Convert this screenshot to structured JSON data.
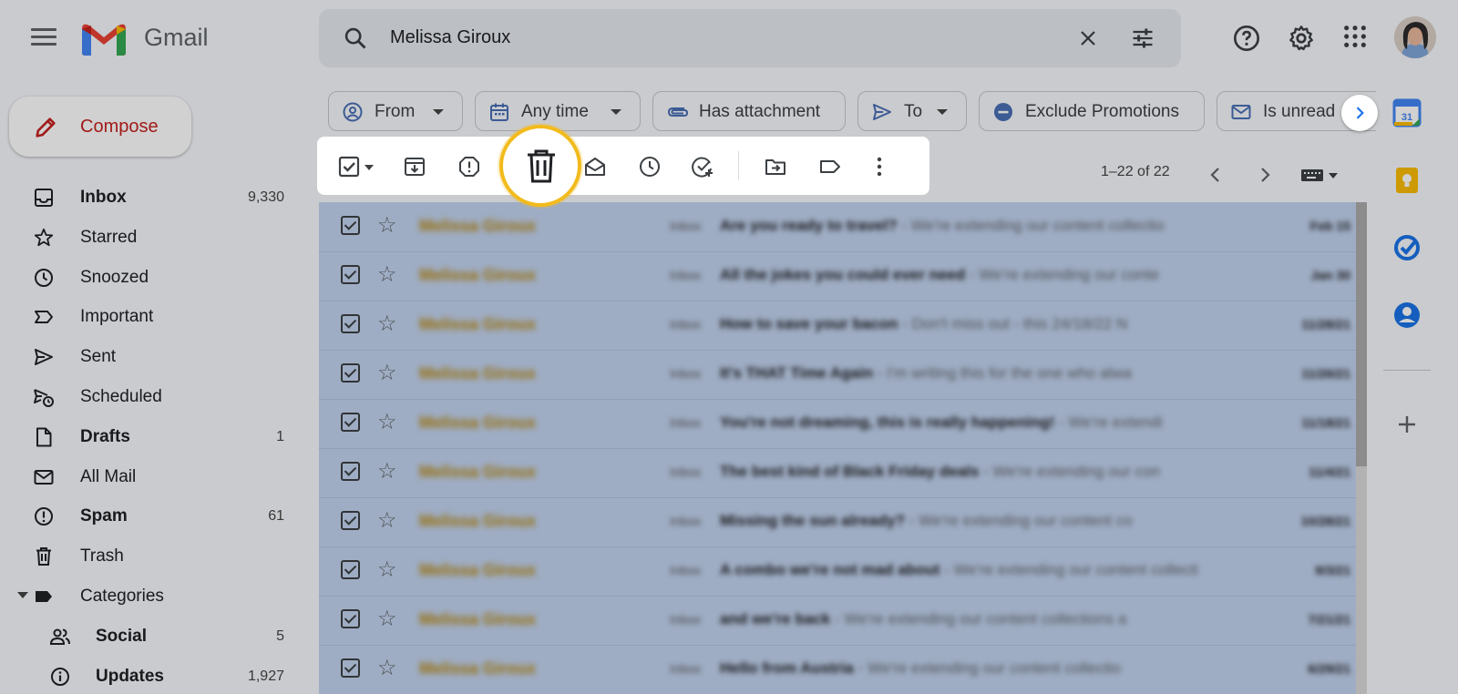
{
  "header": {
    "app_name": "Gmail",
    "search_value": "Melissa Giroux"
  },
  "compose": {
    "label": "Compose"
  },
  "nav": [
    {
      "key": "inbox",
      "label": "Inbox",
      "count": "9,330",
      "bold": true,
      "icon": "inbox-icon"
    },
    {
      "key": "starred",
      "label": "Starred",
      "count": "",
      "bold": false,
      "icon": "star-icon"
    },
    {
      "key": "snoozed",
      "label": "Snoozed",
      "count": "",
      "bold": false,
      "icon": "clock-icon"
    },
    {
      "key": "important",
      "label": "Important",
      "count": "",
      "bold": false,
      "icon": "important-icon"
    },
    {
      "key": "sent",
      "label": "Sent",
      "count": "",
      "bold": false,
      "icon": "send-icon"
    },
    {
      "key": "scheduled",
      "label": "Scheduled",
      "count": "",
      "bold": false,
      "icon": "scheduled-send-icon"
    },
    {
      "key": "drafts",
      "label": "Drafts",
      "count": "1",
      "bold": true,
      "icon": "draft-icon"
    },
    {
      "key": "all-mail",
      "label": "All Mail",
      "count": "",
      "bold": false,
      "icon": "mail-icon"
    },
    {
      "key": "spam",
      "label": "Spam",
      "count": "61",
      "bold": true,
      "icon": "spam-icon"
    },
    {
      "key": "trash",
      "label": "Trash",
      "count": "",
      "bold": false,
      "icon": "trash-icon"
    },
    {
      "key": "categories",
      "label": "Categories",
      "count": "",
      "bold": false,
      "icon": "label-icon"
    },
    {
      "key": "social",
      "label": "Social",
      "count": "5",
      "bold": true,
      "icon": "people-icon"
    },
    {
      "key": "updates",
      "label": "Updates",
      "count": "1,927",
      "bold": true,
      "icon": "info-icon"
    }
  ],
  "chips": [
    {
      "label": "From",
      "icon": "person-icon",
      "caret": true
    },
    {
      "label": "Any time",
      "icon": "calendar-icon",
      "caret": true
    },
    {
      "label": "Has attachment",
      "icon": "attachment-icon",
      "caret": false
    },
    {
      "label": "To",
      "icon": "send-icon",
      "caret": true
    },
    {
      "label": "Exclude Promotions",
      "icon": "minus-circle-icon",
      "caret": false
    },
    {
      "label": "Is unread",
      "icon": "mail-icon",
      "caret": false
    }
  ],
  "pager": {
    "range": "1–22 of 22"
  },
  "emails": [
    {
      "sender": "Melissa Giroux",
      "tag": "Inbox",
      "subject": "Are you ready to travel?",
      "snippet": " - We're extending our content collectio",
      "date": "Feb 15"
    },
    {
      "sender": "Melissa Giroux",
      "tag": "Inbox",
      "subject": "All the jokes you could ever need",
      "snippet": " - We're extending our conte",
      "date": "Jan 30"
    },
    {
      "sender": "Melissa Giroux",
      "tag": "Inbox",
      "subject": "How to save your bacon",
      "snippet": " - Don't miss out - this 24/18/22 N",
      "date": "11/28/21"
    },
    {
      "sender": "Melissa Giroux",
      "tag": "Inbox",
      "subject": "It's THAT Time Again",
      "snippet": " - I'm writing this for the one who alwa",
      "date": "11/26/21"
    },
    {
      "sender": "Melissa Giroux",
      "tag": "Inbox",
      "subject": "You're not dreaming, this is really happening!",
      "snippet": " - We're extendi",
      "date": "11/18/21"
    },
    {
      "sender": "Melissa Giroux",
      "tag": "Inbox",
      "subject": "The best kind of Black Friday deals",
      "snippet": " - We're extending our con",
      "date": "11/4/21"
    },
    {
      "sender": "Melissa Giroux",
      "tag": "Inbox",
      "subject": "Missing the sun already?",
      "snippet": " - We're extending our content co",
      "date": "10/28/21"
    },
    {
      "sender": "Melissa Giroux",
      "tag": "Inbox",
      "subject": "A combo we're not mad about",
      "snippet": " - We're extending our content collecti",
      "date": "9/3/21"
    },
    {
      "sender": "Melissa Giroux",
      "tag": "Inbox",
      "subject": "and we're back",
      "snippet": " - We're extending our content collections a",
      "date": "7/21/21"
    },
    {
      "sender": "Melissa Giroux",
      "tag": "Inbox",
      "subject": "Hello from Austria",
      "snippet": " - We're extending our content collectio",
      "date": "6/29/21"
    }
  ],
  "colors": {
    "highlight_ring": "#f2bb1d",
    "selected_row": "#c2d3ef",
    "compose_text": "#c5221f"
  }
}
